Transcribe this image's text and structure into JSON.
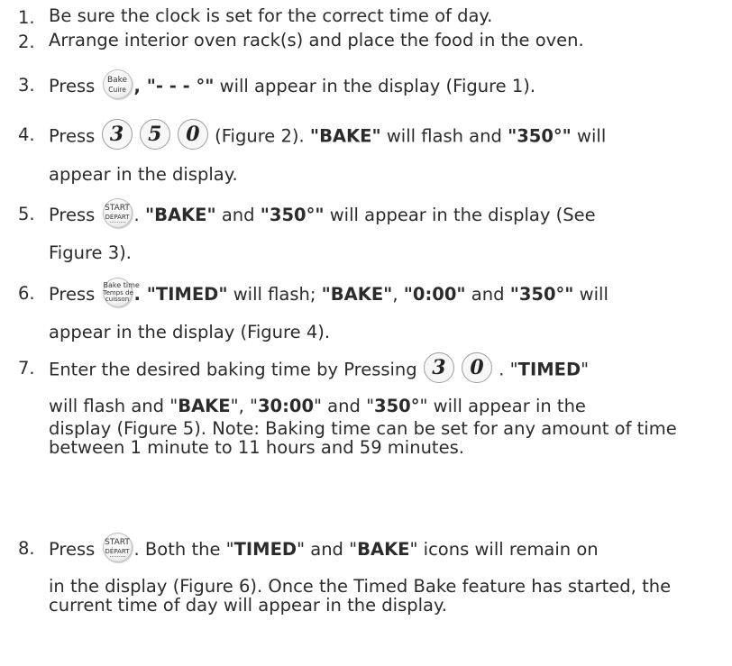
{
  "steps": [
    {
      "num": "1.",
      "text": "Be sure the clock is set for the correct time of day."
    },
    {
      "num": "2.",
      "text": "Arrange interior oven rack(s) and place the food in the oven."
    },
    {
      "num": "3.",
      "a": "Press",
      "btn_top": "Bake",
      "btn_bottom": "Cuire",
      "b": ", \"- - - °\"",
      "c": " will appear in the display (Figure 1)."
    },
    {
      "num": "4.",
      "a": "Press",
      "keys": [
        "3",
        "5",
        "0"
      ],
      "b": " (Figure 2). ",
      "c": "\"BAKE\"",
      "d": " will flash and ",
      "e": "\"350°\"",
      "f": " will",
      "line2": "appear in the display."
    },
    {
      "num": "5.",
      "a": "Press",
      "btn_top": "START",
      "btn_bottom": "DÉPART",
      "b": ". ",
      "c": "\"BAKE\"",
      "d": " and ",
      "e": "\"350°\"",
      "f": " will appear in the display (See",
      "line2": "Figure 3)."
    },
    {
      "num": "6.",
      "a": "Press",
      "btn_top": "Bake time",
      "btn_mid": "Temps de",
      "btn_bottom": "cuisson",
      "b": ". \"TIMED\"",
      "c": " will flash; ",
      "d": "\"BAKE\"",
      "e": ",  ",
      "f": "\"0:00\"",
      "g": " and ",
      "h": "\"350°\"",
      "i": " will",
      "line2": "appear in the display (Figure 4)."
    },
    {
      "num": "7.",
      "a": "Enter the desired baking time by Pressing",
      "keys": [
        "3",
        "0"
      ],
      "b": " . \"",
      "c": "TIMED",
      "d": "\"",
      "l2a": "will flash and \"",
      "l2b": "BAKE",
      "l2c": "\", \"",
      "l2d": "30:00",
      "l2e": "\" and \"",
      "l2f": "350°",
      "l2g": "\" will appear in the",
      "rest": "display (Figure 5). Note: Baking time can be set for any amount of time between 1 minute to 11 hours and 59 minutes."
    },
    {
      "num": "8.",
      "a": "Press",
      "btn_top": "START",
      "btn_bottom": "DÉPART",
      "b": ". Both the \"",
      "c": "TIMED",
      "d": "\" and \"",
      "e": "BAKE",
      "f": "\" icons will remain on",
      "l2": "in the display (Figure 6).  Once the Timed Bake feature has started, the current time of day will appear in the display."
    }
  ]
}
